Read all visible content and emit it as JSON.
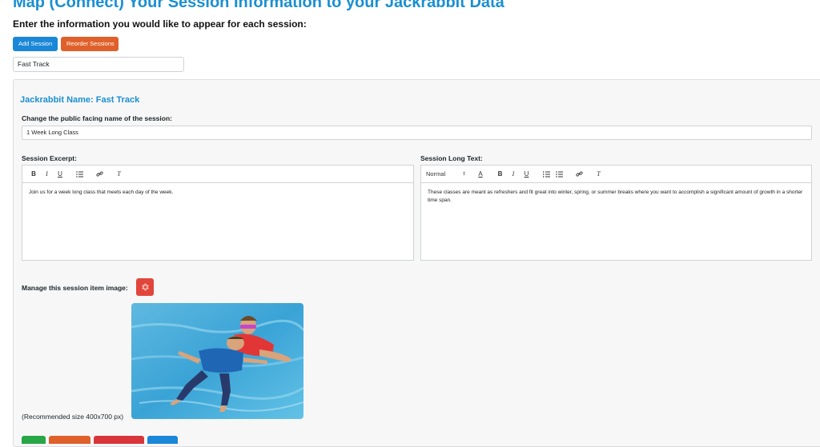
{
  "page": {
    "title": "Map (Connect) Your Session Information to your Jackrabbit Data",
    "instructions": "Enter the information you would like to appear for each session:"
  },
  "toolbar": {
    "add_session_label": "Add Session",
    "reorder_sessions_label": "Reorder Sessions"
  },
  "session_tab": {
    "label": "Fast Track"
  },
  "session": {
    "jackrabbit_name": "Jackrabbit Name: Fast Track",
    "public_name_label": "Change the public facing name of the session:",
    "public_name_value": "1 Week Long Class",
    "excerpt": {
      "label": "Session Excerpt:",
      "text": "Join us for a week long class that meets each day of the week."
    },
    "long_text": {
      "label": "Session Long Text:",
      "format_select": "Normal",
      "text": "These classes are meant as refreshers and fit great into winter, spring, or summer breaks where you want to accomplish a significant amount of growth in a shorter time span."
    },
    "image": {
      "label": "Manage this session item image:",
      "recommended_size": "(Recommended size 400x700 px)"
    }
  },
  "editor_toolbar": {
    "bold": "B",
    "italic": "I",
    "underline": "U",
    "font_color": "A",
    "clear_format": "T"
  },
  "icons": {
    "gear": "gear-icon",
    "bullet_list": "bullet-list-icon",
    "ordered_list": "ordered-list-icon",
    "link": "link-icon",
    "clear_format": "clear-format-icon",
    "chevron": "chevron-updown-icon"
  },
  "colors": {
    "accent_blue": "#1a8fd1",
    "button_blue": "#1a87d8",
    "button_orange": "#e0602a",
    "button_red": "#e2453b",
    "button_green": "#27a745"
  }
}
